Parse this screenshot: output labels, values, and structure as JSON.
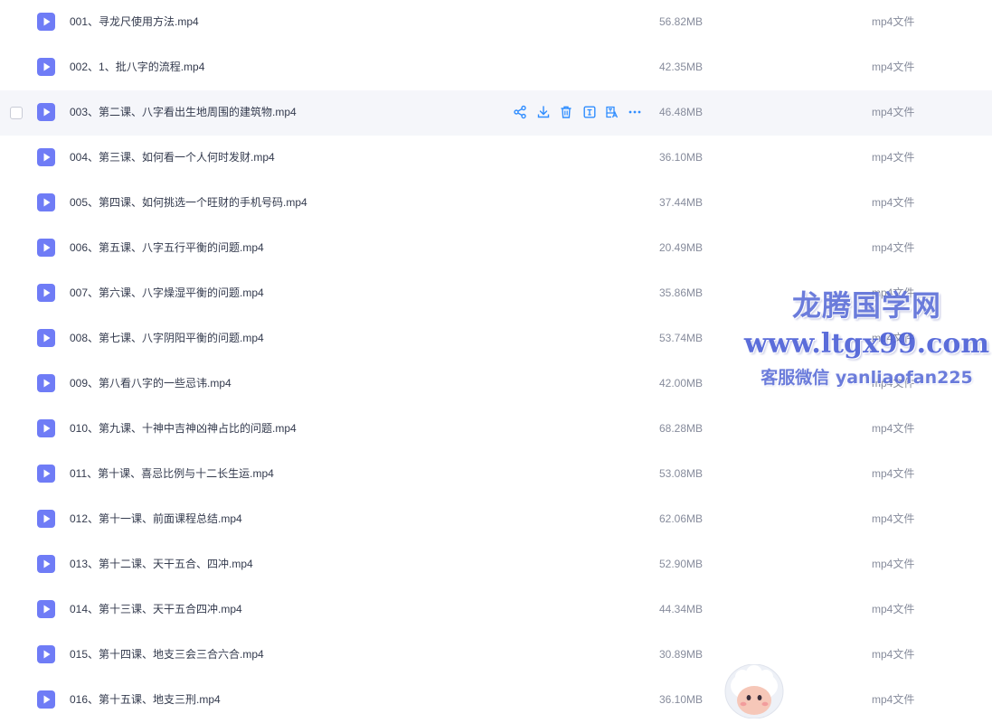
{
  "files": [
    {
      "name": "001、寻龙尺使用方法.mp4",
      "size": "56.82MB",
      "type": "mp4文件"
    },
    {
      "name": "002、1、批八字的流程.mp4",
      "size": "42.35MB",
      "type": "mp4文件"
    },
    {
      "name": "003、第二课、八字看出生地周围的建筑物.mp4",
      "size": "46.48MB",
      "type": "mp4文件"
    },
    {
      "name": "004、第三课、如何看一个人何时发财.mp4",
      "size": "36.10MB",
      "type": "mp4文件"
    },
    {
      "name": "005、第四课、如何挑选一个旺财的手机号码.mp4",
      "size": "37.44MB",
      "type": "mp4文件"
    },
    {
      "name": "006、第五课、八字五行平衡的问题.mp4",
      "size": "20.49MB",
      "type": "mp4文件"
    },
    {
      "name": "007、第六课、八字燥湿平衡的问题.mp4",
      "size": "35.86MB",
      "type": "mp4文件"
    },
    {
      "name": "008、第七课、八字阴阳平衡的问题.mp4",
      "size": "53.74MB",
      "type": "mp4文件"
    },
    {
      "name": "009、第八看八字的一些忌讳.mp4",
      "size": "42.00MB",
      "type": "mp4文件"
    },
    {
      "name": "010、第九课、十神中吉神凶神占比的问题.mp4",
      "size": "68.28MB",
      "type": "mp4文件"
    },
    {
      "name": "011、第十课、喜忌比例与十二长生运.mp4",
      "size": "53.08MB",
      "type": "mp4文件"
    },
    {
      "name": "012、第十一课、前面课程总结.mp4",
      "size": "62.06MB",
      "type": "mp4文件"
    },
    {
      "name": "013、第十二课、天干五合、四冲.mp4",
      "size": "52.90MB",
      "type": "mp4文件"
    },
    {
      "name": "014、第十三课、天干五合四冲.mp4",
      "size": "44.34MB",
      "type": "mp4文件"
    },
    {
      "name": "015、第十四课、地支三会三合六合.mp4",
      "size": "30.89MB",
      "type": "mp4文件"
    },
    {
      "name": "016、第十五课、地支三刑.mp4",
      "size": "36.10MB",
      "type": "mp4文件"
    }
  ],
  "hover_row_index": 2,
  "row_actions": [
    "share-icon",
    "download-icon",
    "delete-icon",
    "rename-icon",
    "translate-icon",
    "more-icon"
  ],
  "icons": {
    "file_type_icon": "video-play-icon"
  },
  "colors": {
    "accent": "#6f7cf6",
    "hover_bg": "#f5f6fa",
    "action": "#2f8dff"
  },
  "watermark": {
    "line1": "龙腾国学网",
    "line2": "www.ltgx99.com",
    "line3": "客服微信 yanliaofan225"
  }
}
